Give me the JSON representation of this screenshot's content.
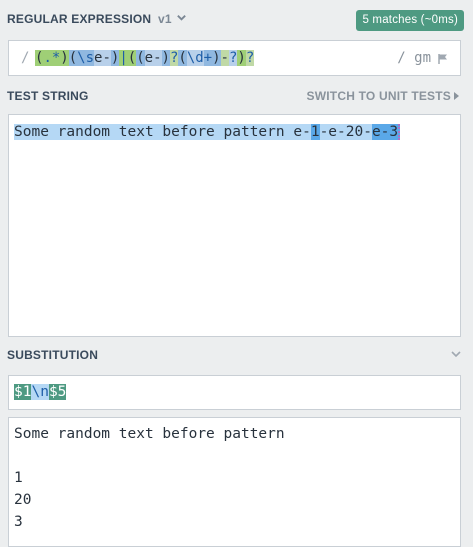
{
  "regex": {
    "title": "REGULAR EXPRESSION",
    "version": "v1",
    "match_badge": "5 matches (~0ms)",
    "open_delim": "/",
    "pattern_parts": [
      "(",
      ".*",
      ")",
      "(",
      "\\s",
      "e-",
      ")",
      "|",
      "(",
      "(",
      "e-",
      ")",
      "?",
      "(",
      "\\d",
      "+",
      ")",
      "-",
      "?",
      ")",
      "?"
    ],
    "close_delim": "/ gm"
  },
  "test": {
    "title": "TEST STRING",
    "unit_tests_link": "SWITCH TO UNIT TESTS",
    "segments": [
      "Some random text before pattern",
      " e-",
      "1",
      "-e-20-",
      "e-3"
    ]
  },
  "substitution": {
    "title": "SUBSTITUTION",
    "parts": [
      "$1",
      "\\n",
      "$5"
    ],
    "result_lines": [
      "Some random text before pattern",
      "",
      "1",
      "20",
      "3"
    ]
  },
  "colors": {
    "badge": "#4e9a82",
    "group1": "#9fcf76",
    "group2": "#90b8e0",
    "match_light": "#b5d8f5",
    "match_dark": "#5aa8e8"
  }
}
